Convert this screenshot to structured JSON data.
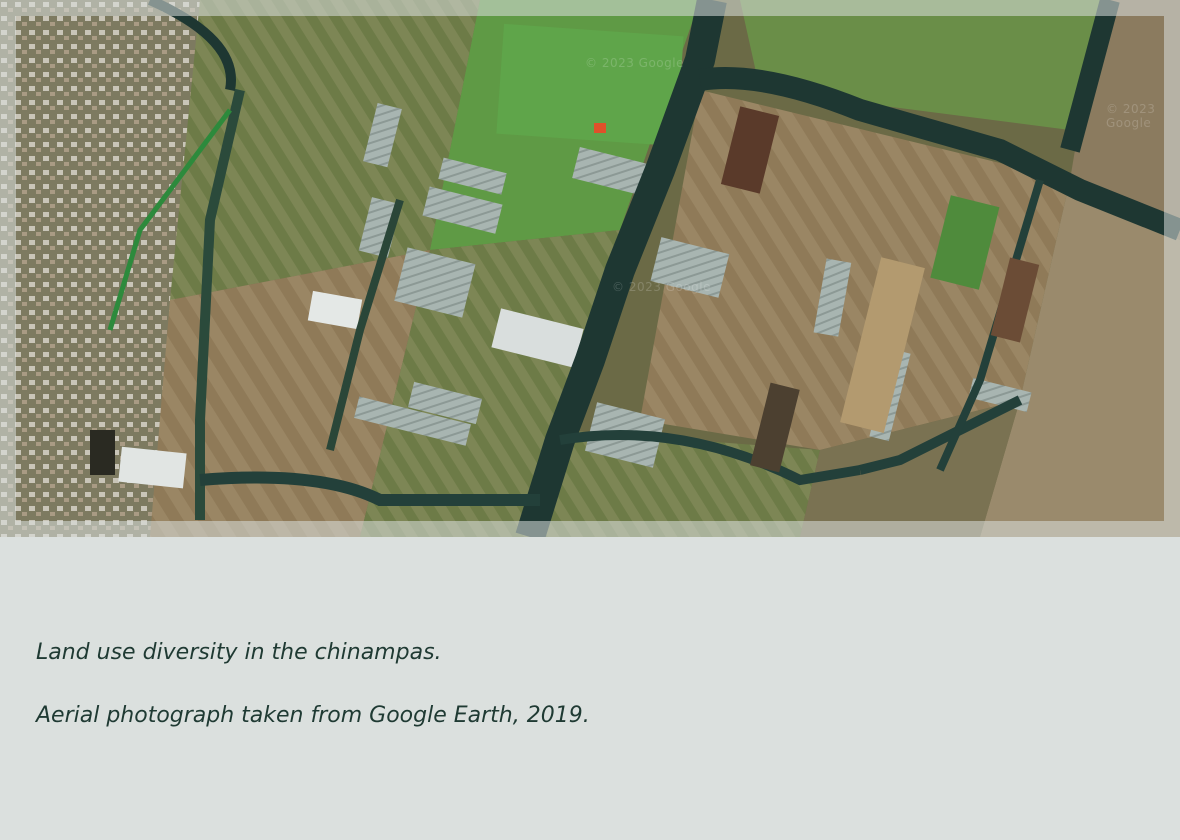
{
  "caption": {
    "title": "Land use diversity in the chinampas.",
    "source": "Aerial photograph taken from Google Earth, 2019."
  },
  "image": {
    "watermark": "© 2023 Google"
  },
  "colors": {
    "background": "#dbe0de",
    "caption_text": "#1f3a33",
    "water": "#1d3530",
    "field_green": "#6f8a4b",
    "field_dry": "#8d7554",
    "greenhouse": "#a9b6b2"
  }
}
